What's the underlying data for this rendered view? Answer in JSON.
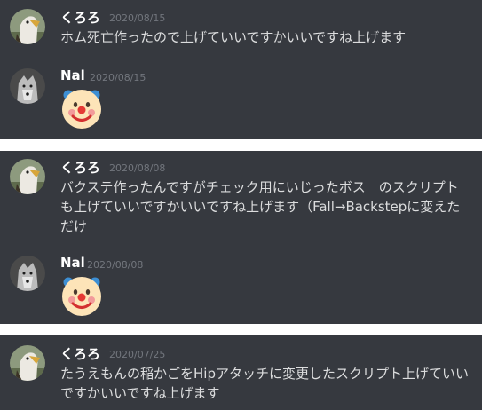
{
  "messages": [
    {
      "author": "くろろ",
      "timestamp": "2020/08/15",
      "content": "ホム死亡作ったので上げていいですかいいですね上げます",
      "avatar_icon": "eagle-avatar-icon"
    },
    {
      "author": "Nal",
      "timestamp": "2020/08/15",
      "content_emoji": "clown-face-icon",
      "avatar_icon": "wolf-avatar-icon"
    },
    {
      "author": "くろろ",
      "timestamp": "2020/08/08",
      "content": "バクステ作ったんですがチェック用にいじったボス　のスクリプトも上げていいですかいいですね上げます（Fall→Backstepに変えただけ",
      "avatar_icon": "eagle-avatar-icon"
    },
    {
      "author": "Nal",
      "timestamp": "2020/08/08",
      "content_emoji": "clown-face-icon",
      "avatar_icon": "wolf-avatar-icon"
    },
    {
      "author": "くろろ",
      "timestamp": "2020/07/25",
      "content": "たうえもんの稲かごをHipアタッチに変更したスクリプト上げていいですかいいですね上げます",
      "avatar_icon": "eagle-avatar-icon"
    }
  ],
  "colors": {
    "background": "#36393f",
    "separator": "#ffffff",
    "username": "#ffffff",
    "timestamp": "#72767d",
    "message_text": "#dcddde"
  }
}
